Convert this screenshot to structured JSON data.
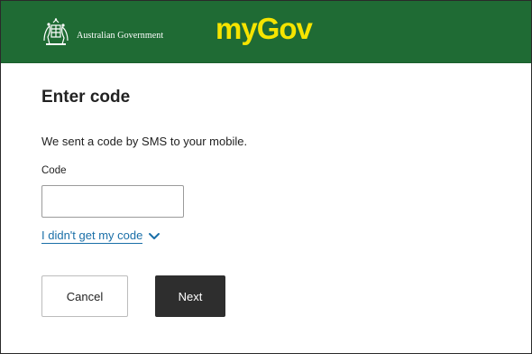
{
  "header": {
    "government_label": "Australian Government",
    "logo_text": "myGov",
    "colors": {
      "background": "#1f6b34",
      "logo": "#f5e400"
    }
  },
  "main": {
    "title": "Enter code",
    "message": "We sent a code by SMS to your mobile.",
    "code_field": {
      "label": "Code",
      "value": "",
      "placeholder": ""
    },
    "no_code_link": {
      "label": "I didn't get my code",
      "icon": "chevron-down-icon",
      "color": "#1a6fa8"
    },
    "buttons": {
      "cancel_label": "Cancel",
      "next_label": "Next",
      "next_color": "#2e2e2e"
    }
  }
}
